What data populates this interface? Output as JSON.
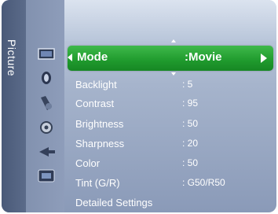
{
  "menu": {
    "category": "Picture",
    "selected": {
      "label": "Mode",
      "value": ":Movie"
    },
    "items": [
      {
        "label": "Backlight",
        "value": ": 5"
      },
      {
        "label": "Contrast",
        "value": ": 95"
      },
      {
        "label": "Brightness",
        "value": ": 50"
      },
      {
        "label": "Sharpness",
        "value": ": 20"
      },
      {
        "label": "Color",
        "value": ": 50"
      },
      {
        "label": "Tint (G/R)",
        "value": ": G50/R50"
      },
      {
        "label": "Detailed Settings",
        "value": ""
      }
    ]
  },
  "icons": [
    "picture-icon",
    "sound-icon",
    "channel-icon",
    "setup-icon",
    "input-icon",
    "application-icon"
  ],
  "colors": {
    "highlight": "#1f9a2d",
    "category_bar": "#4a5a78",
    "panel_top": "#c7d2e3",
    "text": "#ffffff"
  }
}
